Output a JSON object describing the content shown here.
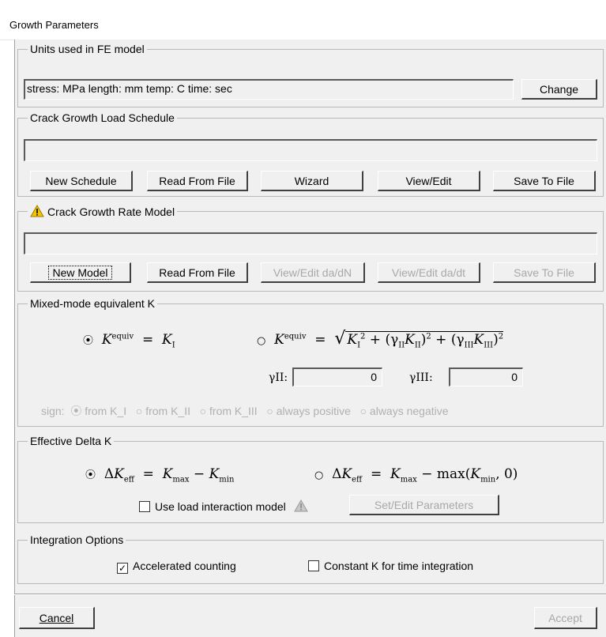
{
  "window": {
    "title": "Growth Parameters"
  },
  "units": {
    "legend": "Units used in FE model",
    "value": "stress: MPa   length: mm   temp: C   time: sec",
    "change_label": "Change"
  },
  "load_schedule": {
    "legend": "Crack Growth Load Schedule",
    "value": "",
    "buttons": [
      "New Schedule",
      "Read From File",
      "Wizard",
      "View/Edit",
      "Save To File"
    ]
  },
  "rate_model": {
    "legend": "Crack Growth Rate Model",
    "value": "",
    "buttons": [
      "New Model",
      "Read From File",
      "View/Edit da/dN",
      "View/Edit da/dt",
      "Save To File"
    ]
  },
  "mixed_mode": {
    "legend": "Mixed-mode equivalent K",
    "gamma_II": "0",
    "gamma_III": "0",
    "sign_label": "sign:",
    "sign_options": [
      "from K_I",
      "from K_II",
      "from K_III",
      "always positive",
      "always negative"
    ],
    "gamma_II_label": "γII:",
    "gamma_III_label": "γIII:"
  },
  "delta_k": {
    "legend": "Effective Delta K",
    "load_interaction_label": "Use load interaction model",
    "set_edit_label": "Set/Edit Parameters"
  },
  "integration": {
    "legend": "Integration Options",
    "accelerated_label": "Accelerated counting",
    "accelerated_checked": true,
    "constant_k_label": "Constant K for time integration",
    "constant_k_checked": false
  },
  "footer": {
    "cancel_label": "Cancel",
    "accept_label": "Accept"
  },
  "colors": {
    "panel": "#f0f0f0",
    "disabled_text": "#a8a8a8",
    "warning": "#f5c400"
  }
}
